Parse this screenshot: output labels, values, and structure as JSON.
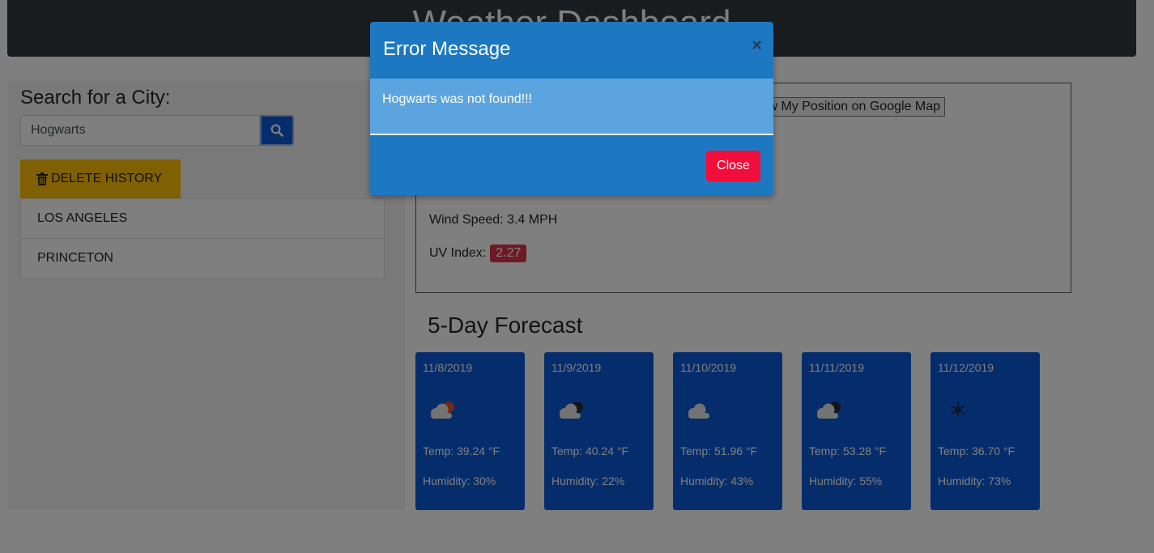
{
  "header": {
    "title": "Weather Dashboard"
  },
  "search": {
    "label": "Search for a City:",
    "value": "Hogwarts"
  },
  "delete_history_label": "DELETE HISTORY",
  "history": [
    "LOS ANGELES",
    "PRINCETON"
  ],
  "current": {
    "map_button": "Show My Position on Google Map",
    "wind": "Wind Speed: 3.4 MPH",
    "uv_label": "UV Index:",
    "uv_value": "2.27"
  },
  "forecast": {
    "title": "5-Day Forecast",
    "days": [
      {
        "date": "11/8/2019",
        "icon": "partly-cloudy-day-icon",
        "temp": "Temp: 39.24 °F",
        "humidity": "Humidity: 30%"
      },
      {
        "date": "11/9/2019",
        "icon": "partly-cloudy-night-icon",
        "temp": "Temp: 40.24 °F",
        "humidity": "Humidity: 22%"
      },
      {
        "date": "11/10/2019",
        "icon": "cloud-icon",
        "temp": "Temp: 51.96 °F",
        "humidity": "Humidity: 43%"
      },
      {
        "date": "11/11/2019",
        "icon": "partly-cloudy-night-icon",
        "temp": "Temp: 53.28 °F",
        "humidity": "Humidity: 55%"
      },
      {
        "date": "11/12/2019",
        "icon": "snow-icon",
        "temp": "Temp: 36.70 °F",
        "humidity": "Humidity: 73%"
      }
    ]
  },
  "modal": {
    "title": "Error Message",
    "close_x": "×",
    "message": "Hogwarts was not found!!!",
    "close_button": "Close"
  },
  "colors": {
    "header_bg": "#343a40",
    "primary": "#0d5ad6",
    "warning": "#ffc107",
    "danger": "#dc3545",
    "modal_bg": "#1e78c1",
    "close_button": "#f20d3a"
  }
}
